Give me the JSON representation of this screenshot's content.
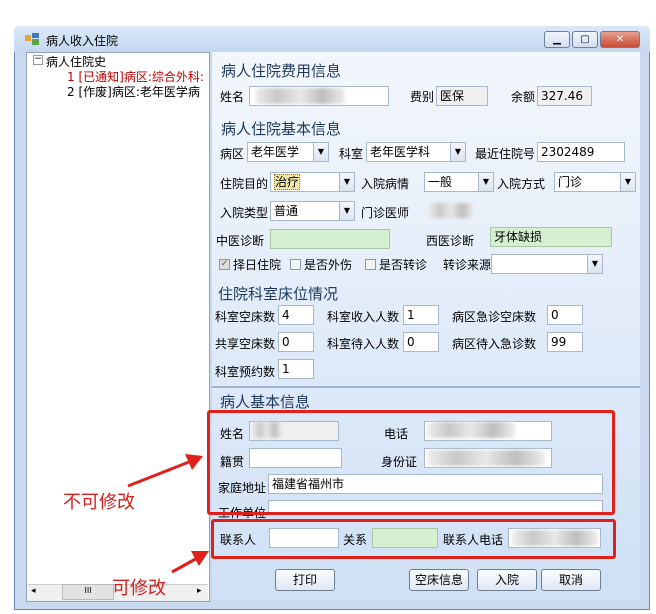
{
  "window": {
    "title": "病人收入住院"
  },
  "tree": {
    "root": "病人住院史",
    "items": [
      "1 [已通知]病区:综合外科:",
      "2 [作废]病区:老年医学病"
    ]
  },
  "fee": {
    "section": "病人住院费用信息",
    "name_label": "姓名",
    "fee_type_label": "费别",
    "fee_type_value": "医保",
    "balance_label": "余额",
    "balance_value": "327.46"
  },
  "basic": {
    "section": "病人住院基本信息",
    "ward_label": "病区",
    "ward_value": "老年医学",
    "dept_label": "科室",
    "dept_value": "老年医学科",
    "last_no_label": "最近住院号",
    "last_no_value": "2302489",
    "purpose_label": "住院目的",
    "purpose_value": "治疗",
    "condition_label": "入院病情",
    "condition_value": "一般",
    "method_label": "入院方式",
    "method_value": "门诊",
    "type_label": "入院类型",
    "type_value": "普通",
    "doctor_label": "门诊医师",
    "tcm_label": "中医诊断",
    "wm_label": "西医诊断",
    "wm_value": "牙体缺损",
    "select_day_label": "择日住院",
    "trauma_label": "是否外伤",
    "transfer_label": "是否转诊",
    "transfer_src_label": "转诊来源"
  },
  "beds": {
    "section": "住院科室床位情况",
    "dept_empty_label": "科室空床数",
    "dept_empty_value": "4",
    "dept_admit_label": "科室收入人数",
    "dept_admit_value": "1",
    "ward_emerg_empty_label": "病区急诊空床数",
    "ward_emerg_empty_value": "0",
    "shared_empty_label": "共享空床数",
    "shared_empty_value": "0",
    "dept_wait_label": "科室待入人数",
    "dept_wait_value": "0",
    "ward_wait_emerg_label": "病区待入急诊数",
    "ward_wait_emerg_value": "99",
    "dept_reserve_label": "科室预约数",
    "dept_reserve_value": "1"
  },
  "patient": {
    "section": "病人基本信息",
    "name_label": "姓名",
    "phone_label": "电话",
    "origin_label": "籍贯",
    "id_label": "身份证",
    "address_label": "家庭地址",
    "address_value": "福建省福州市",
    "work_label": "工作单位",
    "contact_label": "联系人",
    "relation_label": "关系",
    "contact_phone_label": "联系人电话"
  },
  "buttons": {
    "print": "打印",
    "empty_info": "空床信息",
    "admit": "入院",
    "cancel": "取消"
  },
  "annotations": {
    "not_editable": "不可修改",
    "editable": "可修改"
  },
  "colors": {
    "annotation_red": "#e0201b",
    "green_field": "#d4f0d0"
  }
}
